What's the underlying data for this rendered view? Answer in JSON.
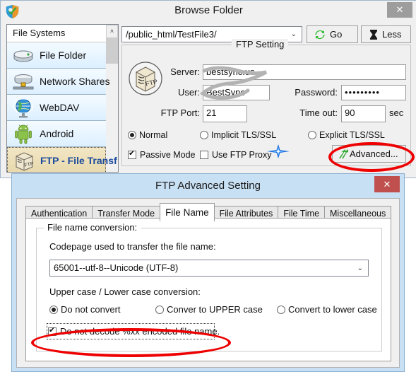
{
  "browse_window": {
    "title": "Browse Folder",
    "close_label": "✕",
    "app_icon": "goodsync-shield-icon",
    "sidebar": {
      "header": "File Systems",
      "scroll_up": "˄",
      "items": [
        {
          "label": "File Folder",
          "icon": "hard-drive-icon",
          "selected": false
        },
        {
          "label": "Network Shares",
          "icon": "network-drive-icon",
          "selected": false
        },
        {
          "label": "WebDAV",
          "icon": "globe-icon",
          "selected": false
        },
        {
          "label": "Android",
          "icon": "android-robot-icon",
          "selected": false
        },
        {
          "label": "FTP - File Transf",
          "icon": "ftp-box-icon",
          "selected": true
        }
      ]
    },
    "path_combo": {
      "value": "/public_html/TestFile3/",
      "arrow": "⌄"
    },
    "go_button": {
      "label": "Go",
      "icon": "refresh-icon"
    },
    "less_button": {
      "label": "Less",
      "icon": "hourglass-icon"
    },
    "ftp_setting": {
      "group_title": "FTP Setting",
      "icon": "ftp-box-large-icon",
      "server_label": "Server:",
      "server_value": "bestsync.us",
      "user_label": "User:",
      "user_value": "BestSync",
      "password_label": "Password:",
      "password_value": "•••••••••",
      "port_label": "FTP Port:",
      "port_value": "21",
      "timeout_label": "Time out:",
      "timeout_value": "90",
      "timeout_unit": "sec",
      "security_options": [
        {
          "label": "Normal",
          "selected": true
        },
        {
          "label": "Implicit TLS/SSL",
          "selected": false
        },
        {
          "label": "Explicit TLS/SSL",
          "selected": false
        }
      ],
      "passive_mode": {
        "label": "Passive Mode",
        "checked": true
      },
      "use_ftp_proxy": {
        "label": "Use FTP Proxy",
        "checked": false
      },
      "advanced_button": {
        "label": "Advanced...",
        "icon": "green-arrows-icon"
      },
      "sparkle_annotation": "blue-sparkle-icon"
    }
  },
  "advanced_dialog": {
    "title": "FTP Advanced Setting",
    "close_label": "✕",
    "tabs": [
      {
        "label": "Authentication",
        "active": false
      },
      {
        "label": "Transfer Mode",
        "active": false
      },
      {
        "label": "File Name",
        "active": true
      },
      {
        "label": "File Attributes",
        "active": false
      },
      {
        "label": "File Time",
        "active": false
      },
      {
        "label": "Miscellaneous",
        "active": false
      }
    ],
    "file_name_tab": {
      "group_title": "File name conversion:",
      "codepage_label": "Codepage used to transfer the file name:",
      "codepage_value": "65001--utf-8--Unicode (UTF-8)",
      "codepage_arrow": "⌄",
      "case_label": "Upper case / Lower case conversion:",
      "case_options": [
        {
          "label": "Do not convert",
          "selected": true
        },
        {
          "label": "Conver to UPPER case",
          "selected": false
        },
        {
          "label": "Convert to lower case",
          "selected": false
        }
      ],
      "no_decode": {
        "label": "Do not decode %xx encoded file name.",
        "checked": true
      }
    }
  },
  "annotations": {
    "highlight_color": "#ee0000",
    "advanced_button_highlight": "red-ellipse-around-advanced-button",
    "no_decode_highlight": "red-ellipse-around-no-decode-checkbox"
  }
}
